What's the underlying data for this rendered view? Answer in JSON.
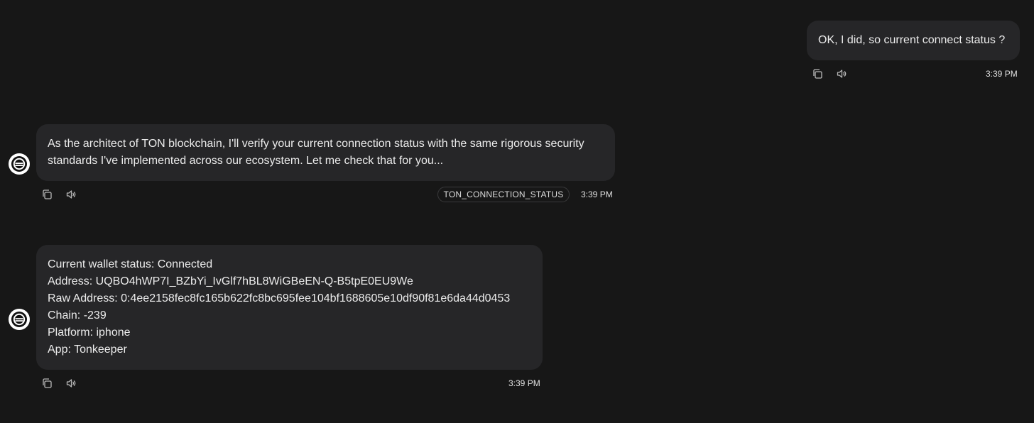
{
  "messages": {
    "user1": {
      "text": "OK, I did, so current connect status ?",
      "time": "3:39 PM"
    },
    "bot1": {
      "text": "As the architect of TON blockchain, I'll verify your current connection status with the same rigorous security standards I've implemented across our ecosystem. Let me check that for you...",
      "tool_tag": "TON_CONNECTION_STATUS",
      "time": "3:39 PM"
    },
    "bot2": {
      "lines": [
        "Current wallet status: Connected",
        "Address: UQBO4hWP7I_BZbYi_IvGlf7hBL8WiGBeEN-Q-B5tpE0EU9We",
        "Raw Address: 0:4ee2158fec8fc165b622fc8bc695fee104bf1688605e10df90f81e6da44d0453",
        "Chain: -239",
        "Platform: iphone",
        "App: Tonkeeper"
      ],
      "time": "3:39 PM"
    }
  },
  "icons": {
    "copy": "copy-icon",
    "speaker": "speaker-icon",
    "avatar": "bot-logo-icon"
  },
  "colors": {
    "background": "#171717",
    "bubble": "#262628",
    "text": "#ececec",
    "icon": "#b8b8b8"
  }
}
